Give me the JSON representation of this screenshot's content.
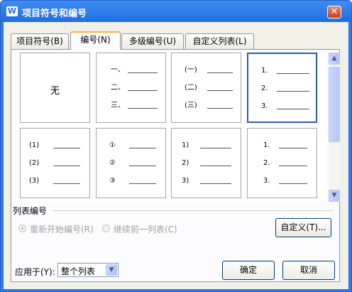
{
  "window": {
    "title": "项目符号和编号",
    "app_icon_glyph": "W",
    "close_glyph": "✕"
  },
  "tabs": [
    {
      "label": "项目符号(B)",
      "active": false
    },
    {
      "label": "编号(N)",
      "active": true
    },
    {
      "label": "多级编号(U)",
      "active": false
    },
    {
      "label": "自定义列表(L)",
      "active": false
    }
  ],
  "gallery": {
    "selected_index": 3,
    "cells": [
      {
        "type": "none",
        "label": "无"
      },
      {
        "type": "list",
        "markers": [
          "一、",
          "二、",
          "三、"
        ]
      },
      {
        "type": "list",
        "markers": [
          "(一)",
          "(二)",
          "(三)"
        ]
      },
      {
        "type": "list",
        "markers": [
          "1.",
          "2.",
          "3."
        ]
      },
      {
        "type": "list",
        "markers": [
          "(1)",
          "(2)",
          "(3)"
        ]
      },
      {
        "type": "list",
        "markers": [
          "①",
          "②",
          "③"
        ]
      },
      {
        "type": "list",
        "markers": [
          "1)",
          "2)",
          "3)"
        ]
      },
      {
        "type": "list",
        "markers": [
          "1.",
          "2.",
          "3."
        ]
      }
    ]
  },
  "scrollbar": {
    "up_glyph": "▲",
    "down_glyph": "▼"
  },
  "list_numbering": {
    "group_label": "列表编号",
    "restart_label": "重新开始编号(R)",
    "continue_label": "继续前一列表(C)",
    "restart_selected": true,
    "enabled": false
  },
  "buttons": {
    "customize": "自定义(T)...",
    "ok": "确定",
    "cancel": "取消"
  },
  "apply_to": {
    "label": "应用于(Y):",
    "value": "整个列表",
    "arrow_glyph": "▼"
  }
}
